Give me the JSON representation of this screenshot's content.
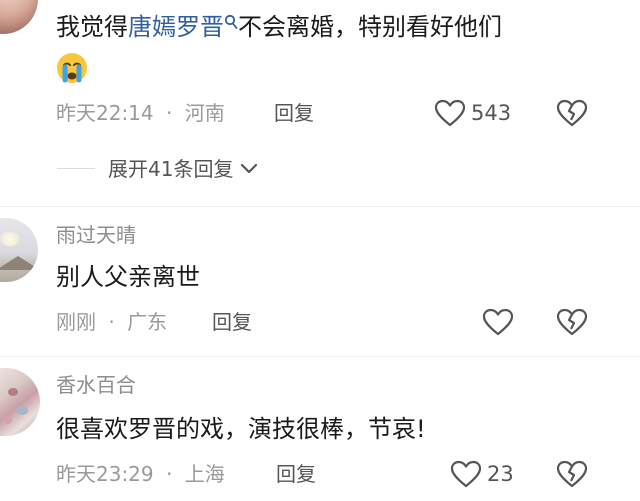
{
  "comments": [
    {
      "text_before": "我觉得",
      "link_text": "唐嫣罗晋",
      "text_after": "不会离婚，特别看好他们",
      "emoji_name": "crying-face-emoji",
      "time": "昨天22:14",
      "location": "河南",
      "reply_label": "回复",
      "likes": "543",
      "expand_label": "展开41条回复"
    },
    {
      "username": "雨过天晴",
      "text": "别人父亲离世",
      "time": "刚刚",
      "location": "广东",
      "reply_label": "回复"
    },
    {
      "username": "香水百合",
      "text": "很喜欢罗晋的戏，演技很棒，节哀!",
      "time": "昨天23:29",
      "location": "上海",
      "reply_label": "回复",
      "likes": "23"
    }
  ],
  "separator": "·",
  "icons": [
    "search-icon",
    "heart-icon",
    "broken-heart-icon",
    "chevron-down-icon"
  ],
  "colors": {
    "link": "#2f5f9e",
    "meta": "#9a9a9a",
    "text": "#1a1a1a"
  }
}
